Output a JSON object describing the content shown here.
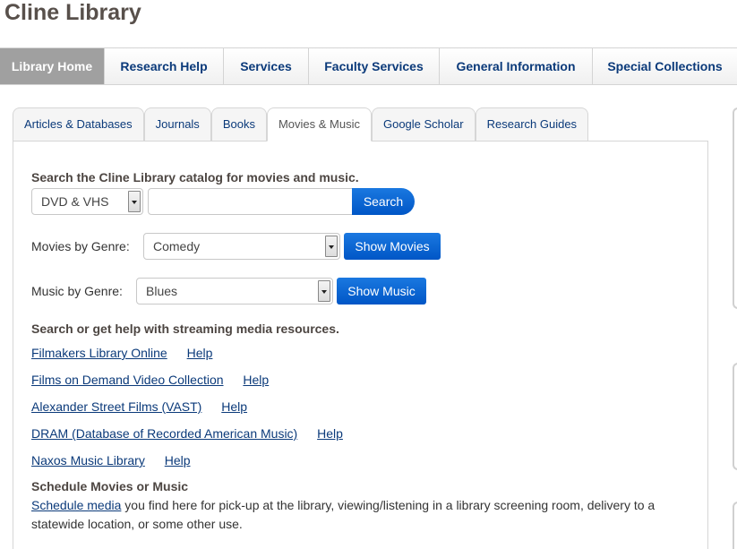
{
  "site": {
    "title": "Cline Library"
  },
  "main_nav": {
    "items": [
      {
        "label": "Library Home",
        "active": true
      },
      {
        "label": "Research Help",
        "active": false
      },
      {
        "label": "Services",
        "active": false
      },
      {
        "label": "Faculty Services",
        "active": false
      },
      {
        "label": "General Information",
        "active": false
      },
      {
        "label": "Special Collections",
        "active": false
      }
    ]
  },
  "tabs": {
    "items": [
      {
        "label": "Articles & Databases",
        "active": false
      },
      {
        "label": "Journals",
        "active": false
      },
      {
        "label": "Books",
        "active": false
      },
      {
        "label": "Movies & Music",
        "active": true
      },
      {
        "label": "Google Scholar",
        "active": false
      },
      {
        "label": "Research Guides",
        "active": false
      }
    ]
  },
  "catalog_search": {
    "heading": "Search the Cline Library catalog for movies and music.",
    "format_select": {
      "selected": "DVD & VHS"
    },
    "query_input": {
      "value": "",
      "placeholder": ""
    },
    "search_button": "Search"
  },
  "movies_genre": {
    "label": "Movies by Genre:",
    "select": {
      "selected": "Comedy"
    },
    "button": "Show Movies"
  },
  "music_genre": {
    "label": "Music by Genre:",
    "select": {
      "selected": "Blues"
    },
    "button": "Show Music"
  },
  "streaming": {
    "heading": "Search or get help with streaming media resources.",
    "resources": [
      {
        "name": "Filmakers Library Online",
        "help": "Help"
      },
      {
        "name": "Films on Demand Video Collection",
        "help": "Help"
      },
      {
        "name": "Alexander Street Films (VAST)",
        "help": "Help"
      },
      {
        "name": "DRAM (Database of Recorded American Music)",
        "help": "Help"
      },
      {
        "name": "Naxos Music Library",
        "help": "Help"
      }
    ]
  },
  "schedule": {
    "heading": "Schedule Movies or Music",
    "link": "Schedule media",
    "text": " you find here for pick-up at the library, viewing/listening in a library screening room, delivery to a statewide location, or some other use."
  },
  "colors": {
    "nav_text": "#0b3a7a",
    "nav_active_bg": "#a0a0a0",
    "button_blue": "#0a66d6",
    "title": "#58504b"
  }
}
